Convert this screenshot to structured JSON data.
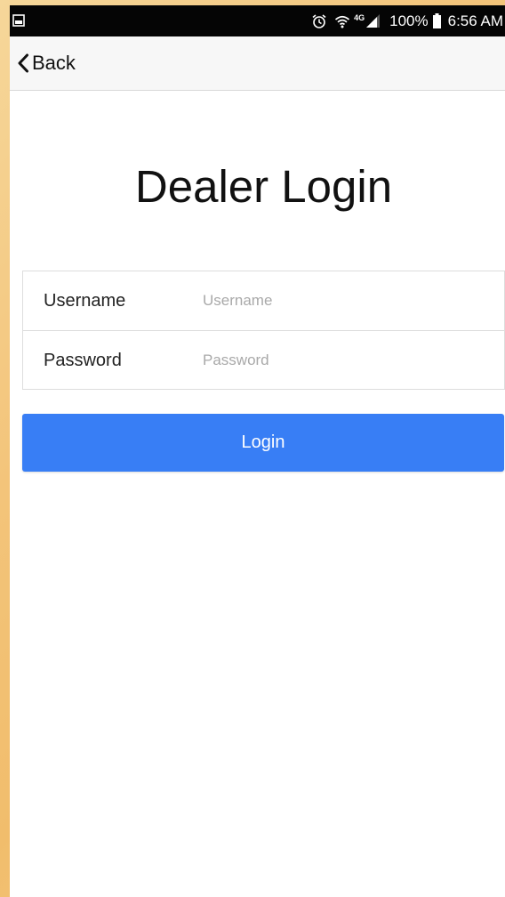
{
  "status_bar": {
    "left_icon": "gallery-notification-icon",
    "alarm_icon": "alarm-icon",
    "wifi_icon": "wifi-icon",
    "network_type": "4G",
    "signal_icon": "signal-icon",
    "battery_percent": "100%",
    "battery_icon": "battery-icon",
    "time": "6:56 AM"
  },
  "nav": {
    "back_icon": "chevron-left-icon",
    "back_label": "Back"
  },
  "page": {
    "title": "Dealer Login"
  },
  "form": {
    "username": {
      "label": "Username",
      "placeholder": "Username",
      "value": ""
    },
    "password": {
      "label": "Password",
      "placeholder": "Password",
      "value": ""
    },
    "submit_label": "Login"
  },
  "colors": {
    "status_bar_bg": "#050505",
    "nav_bg": "#f7f7f7",
    "primary_button": "#387ef5",
    "placeholder_text": "#a9a9a9",
    "outer_background": "#f3c47a"
  }
}
